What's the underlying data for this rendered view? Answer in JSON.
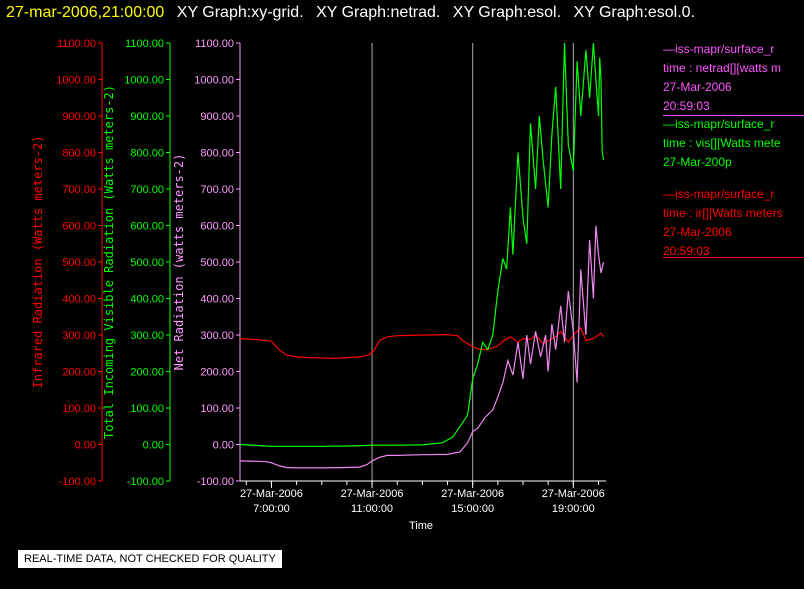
{
  "header": {
    "timestamp": "27-mar-2006,21:00:00",
    "graphs": [
      "XY Graph:xy-grid.",
      "XY Graph:netrad.",
      "XY Graph:esol.",
      "XY Graph:esol.0."
    ]
  },
  "legend": [
    {
      "color": "#ff55ff",
      "lines": [
        "—iss-mapr/surface_r",
        "time : netrad[][watts m",
        "27-Mar-2006",
        "20:59:03"
      ]
    },
    {
      "color": "#00ff00",
      "lines": [
        "—iss-mapr/surface_r",
        "time : vis[][Watts mete",
        "27-Mar-200p"
      ]
    },
    {
      "color": "#ff0000",
      "lines": [
        "—iss-mapr/surface_r",
        "time : ir[][Watts meters",
        "27-Mar-2006",
        "20:59:03"
      ]
    }
  ],
  "quality_note": "REAL-TIME DATA, NOT CHECKED FOR QUALITY",
  "chart_data": {
    "type": "line",
    "xlabel": "Time",
    "x_ticks": [
      {
        "top": "27-Mar-2006",
        "bottom": "7:00:00",
        "hour": 7
      },
      {
        "top": "27-Mar-2006",
        "bottom": "11:00:00",
        "hour": 11
      },
      {
        "top": "27-Mar-2006",
        "bottom": "15:00:00",
        "hour": 15
      },
      {
        "top": "27-Mar-2006",
        "bottom": "19:00:00",
        "hour": 19
      }
    ],
    "xlim": [
      5.75,
      20.3
    ],
    "ylim": [
      -100,
      1100
    ],
    "grid": "vertical lines at major x ticks",
    "y_axes": [
      {
        "label": "Infrared Radiation (Watts meters-2)",
        "color": "#ff0000",
        "ticks": [
          "1100.00",
          "1000.00",
          "900.00",
          "800.00",
          "700.00",
          "600.00",
          "500.00",
          "400.00",
          "300.00",
          "200.00",
          "100.00",
          "0.00",
          "-100.00"
        ]
      },
      {
        "label": "Total Incoming Visible Radiation (Watts meters-2)",
        "color": "#00ff00",
        "ticks": [
          "1100.00",
          "1000.00",
          "900.00",
          "800.00",
          "700.00",
          "600.00",
          "500.00",
          "400.00",
          "300.00",
          "200.00",
          "100.00",
          "0.00",
          "-100.00"
        ]
      },
      {
        "label": "Net Radiation (watts meters-2)",
        "color": "#ff99ff",
        "ticks": [
          "1100.00",
          "1000.00",
          "900.00",
          "800.00",
          "700.00",
          "600.00",
          "500.00",
          "400.00",
          "300.00",
          "200.00",
          "100.00",
          "0.00",
          "-100.00"
        ]
      }
    ],
    "series": [
      {
        "name": "time : ir[][Watts meters-2]",
        "color": "#ff0000",
        "x": [
          5.75,
          6.5,
          7.0,
          7.3,
          7.6,
          8.0,
          8.5,
          9.0,
          9.5,
          10.0,
          10.5,
          10.9,
          11.1,
          11.3,
          11.6,
          12.0,
          12.5,
          13.0,
          13.5,
          14.0,
          14.4,
          14.6,
          14.9,
          15.2,
          15.5,
          15.8,
          16.0,
          16.2,
          16.5,
          16.8,
          17.0,
          17.3,
          17.5,
          17.8,
          18.0,
          18.3,
          18.5,
          18.8,
          19.0,
          19.3,
          19.5,
          19.8,
          20.0,
          20.1,
          20.2
        ],
        "y": [
          290,
          287,
          283,
          260,
          245,
          240,
          238,
          237,
          236,
          238,
          240,
          246,
          260,
          285,
          295,
          298,
          299,
          300,
          300,
          301,
          298,
          285,
          272,
          262,
          260,
          265,
          270,
          283,
          295,
          280,
          290,
          288,
          300,
          275,
          285,
          295,
          310,
          280,
          300,
          320,
          285,
          290,
          300,
          305,
          295
        ]
      },
      {
        "name": "time : vis[][Watts meters-2]",
        "color": "#00ff00",
        "x": [
          5.75,
          6.5,
          7.0,
          8.0,
          9.0,
          10.0,
          10.6,
          11.0,
          12.0,
          13.0,
          13.8,
          14.2,
          14.5,
          14.8,
          15.0,
          15.2,
          15.4,
          15.6,
          15.8,
          16.0,
          16.2,
          16.35,
          16.5,
          16.6,
          16.8,
          17.0,
          17.15,
          17.3,
          17.5,
          17.65,
          17.8,
          18.0,
          18.15,
          18.3,
          18.5,
          18.65,
          18.8,
          19.0,
          19.15,
          19.3,
          19.5,
          19.65,
          19.8,
          19.9,
          20.0,
          20.05,
          20.1,
          20.15,
          20.2
        ],
        "y": [
          0,
          -3,
          -5,
          -5,
          -5,
          -4,
          -3,
          -2,
          -2,
          -1,
          5,
          20,
          50,
          80,
          180,
          220,
          280,
          260,
          300,
          420,
          510,
          480,
          650,
          520,
          800,
          620,
          550,
          880,
          700,
          900,
          780,
          650,
          850,
          980,
          700,
          1100,
          820,
          750,
          1050,
          900,
          1080,
          950,
          1100,
          1000,
          900,
          1060,
          1000,
          800,
          780
        ]
      },
      {
        "name": "time : netrad[][watts meters-2]",
        "color": "#ee88ee",
        "x": [
          5.75,
          6.5,
          6.8,
          7.0,
          7.3,
          7.6,
          8.0,
          9.0,
          10.0,
          10.5,
          10.8,
          11.0,
          11.3,
          11.6,
          12.0,
          13.0,
          14.0,
          14.5,
          14.8,
          15.0,
          15.2,
          15.5,
          15.8,
          16.0,
          16.2,
          16.4,
          16.6,
          16.8,
          17.0,
          17.15,
          17.3,
          17.5,
          17.7,
          17.9,
          18.0,
          18.15,
          18.3,
          18.5,
          18.65,
          18.8,
          19.0,
          19.15,
          19.3,
          19.5,
          19.65,
          19.8,
          19.9,
          20.0,
          20.1,
          20.2
        ],
        "y": [
          -45,
          -46,
          -47,
          -50,
          -58,
          -63,
          -64,
          -64,
          -63,
          -62,
          -55,
          -45,
          -35,
          -30,
          -30,
          -28,
          -27,
          -20,
          5,
          35,
          45,
          75,
          95,
          130,
          170,
          230,
          190,
          280,
          180,
          300,
          220,
          310,
          240,
          300,
          200,
          330,
          260,
          380,
          280,
          420,
          310,
          170,
          480,
          300,
          560,
          400,
          600,
          520,
          470,
          500
        ]
      }
    ]
  }
}
